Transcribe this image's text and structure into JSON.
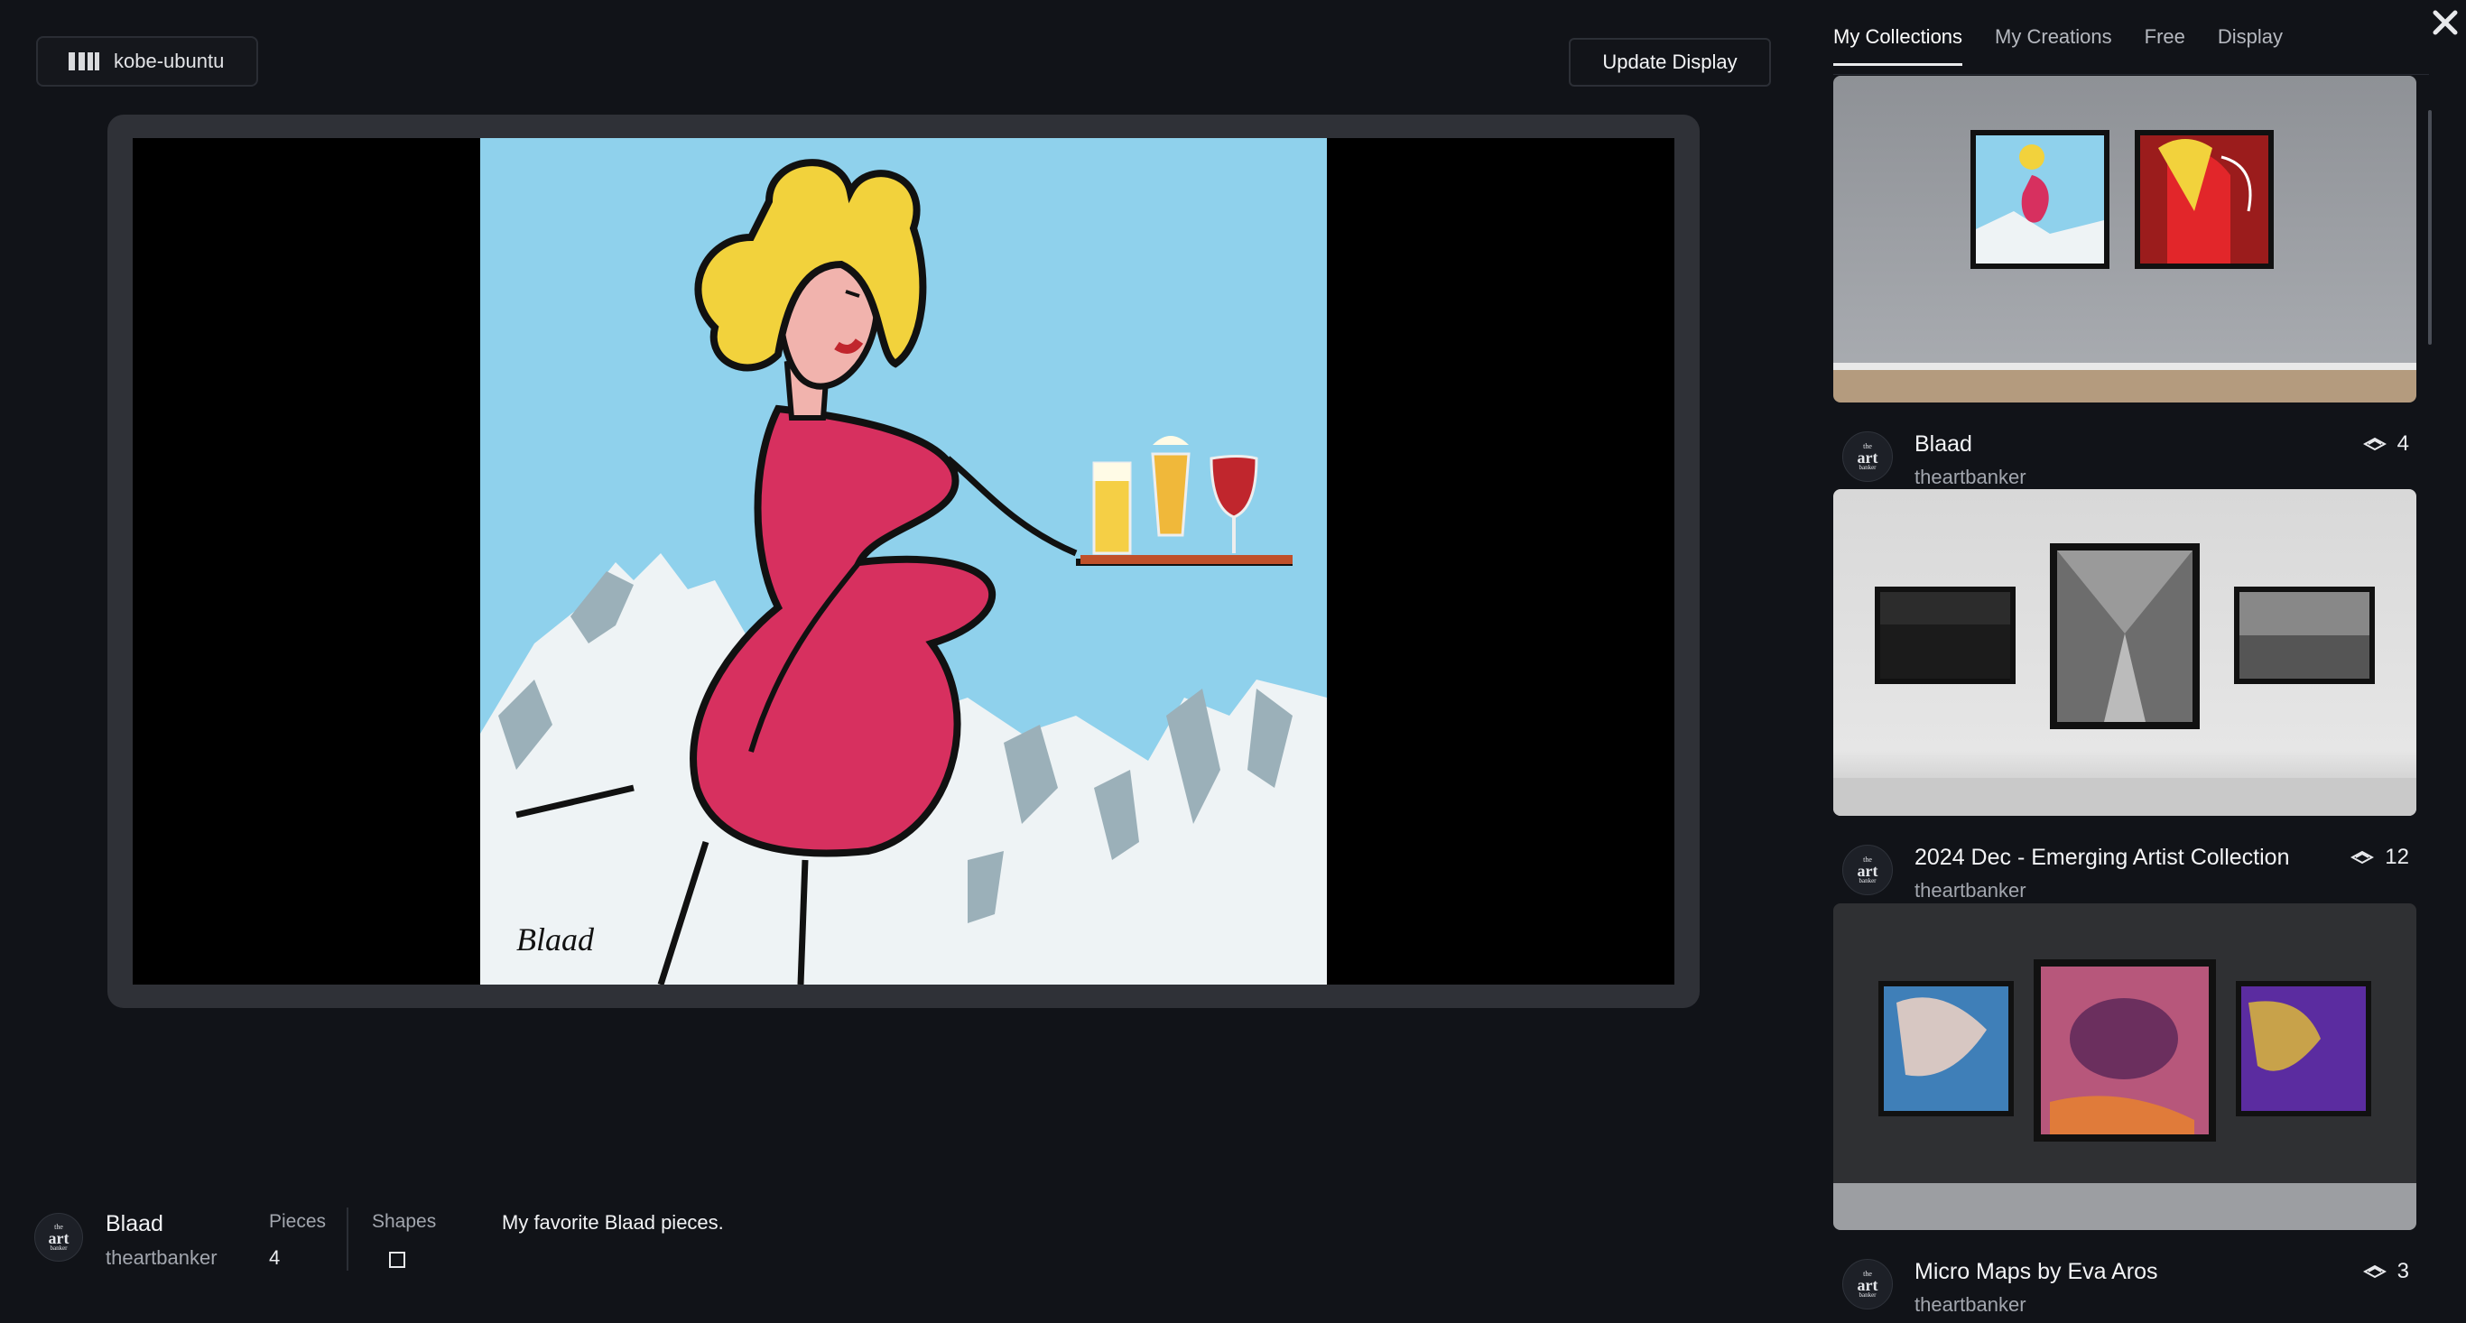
{
  "device": {
    "name": "kobe-ubuntu",
    "icon": "display-logo-icon"
  },
  "toolbar": {
    "update_label": "Update Display"
  },
  "current": {
    "name": "Blaad",
    "owner": "theartbanker",
    "pieces_label": "Pieces",
    "pieces_value": "4",
    "shapes_label": "Shapes",
    "shape_icon": "square-shape-icon",
    "description": "My favorite Blaad pieces."
  },
  "avatar": {
    "the": "the",
    "art": "art",
    "banker": "banker"
  },
  "tabs": [
    {
      "label": "My Collections",
      "active": true
    },
    {
      "label": "My Creations",
      "active": false
    },
    {
      "label": "Free",
      "active": false
    },
    {
      "label": "Display",
      "active": false
    }
  ],
  "collections": [
    {
      "title": "Blaad",
      "owner": "theartbanker",
      "count": "4"
    },
    {
      "title": "2024 Dec - Emerging Artist Collection",
      "owner": "theartbanker",
      "count": "12"
    },
    {
      "title": "Micro Maps by Eva Aros",
      "owner": "theartbanker",
      "count": "3"
    }
  ],
  "artwork": {
    "signature": "Blaad"
  },
  "colors": {
    "background": "#111318",
    "tv_frame": "#2f3137",
    "sky": "#8fd1ec",
    "dress": "#d7305f",
    "hair": "#f2d23c"
  }
}
